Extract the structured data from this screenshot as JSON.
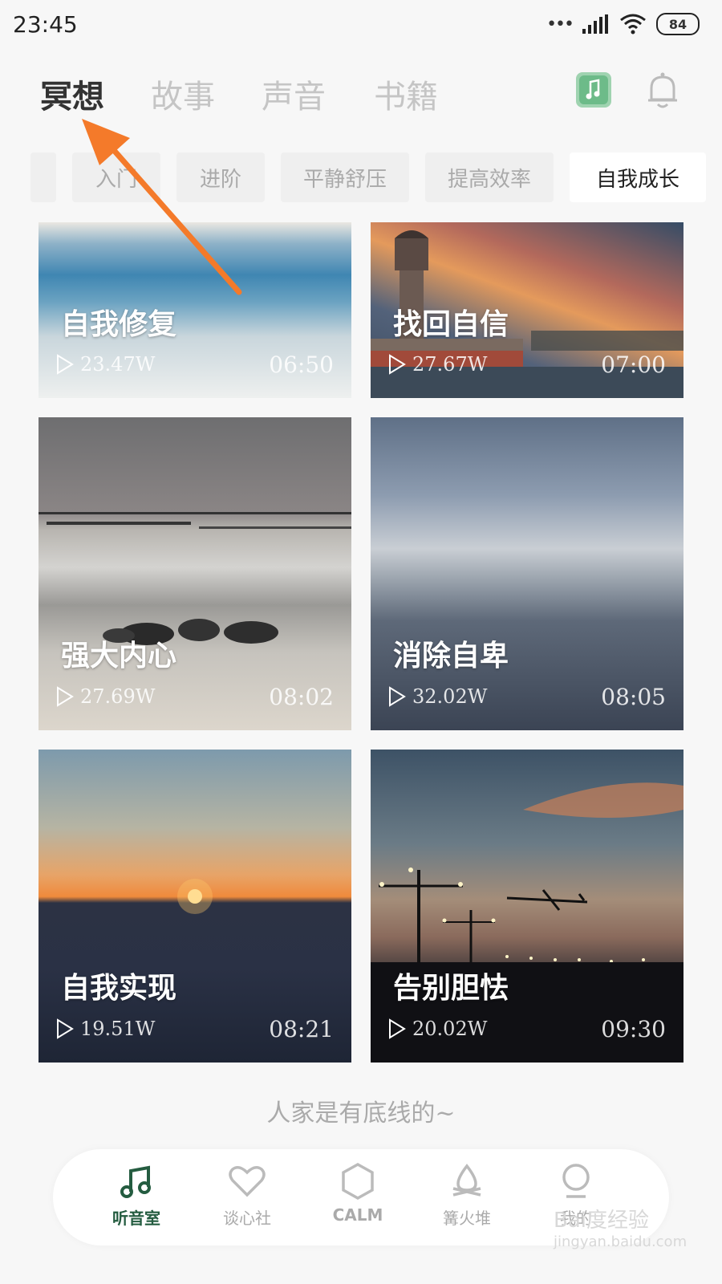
{
  "status_bar": {
    "time": "23:45",
    "battery": "84"
  },
  "top_nav": {
    "tabs": [
      "冥想",
      "故事",
      "声音",
      "书籍"
    ],
    "active_index": 0
  },
  "categories": {
    "items": [
      "",
      "入门",
      "进阶",
      "平静舒压",
      "提高效率",
      "自我成长"
    ],
    "active_index": 5
  },
  "cards": [
    {
      "title": "自我修复",
      "plays": "23.47W",
      "duration": "06:50"
    },
    {
      "title": "找回自信",
      "plays": "27.67W",
      "duration": "07:00"
    },
    {
      "title": "强大内心",
      "plays": "27.69W",
      "duration": "08:02"
    },
    {
      "title": "消除自卑",
      "plays": "32.02W",
      "duration": "08:05"
    },
    {
      "title": "自我实现",
      "plays": "19.51W",
      "duration": "08:21"
    },
    {
      "title": "告别胆怯",
      "plays": "20.02W",
      "duration": "09:30"
    }
  ],
  "footer_message": "人家是有底线的~",
  "tab_bar": {
    "items": [
      {
        "label": "听音室",
        "icon": "music-note-icon"
      },
      {
        "label": "谈心社",
        "icon": "heart-icon"
      },
      {
        "label": "CALM",
        "icon": "hexagon-icon"
      },
      {
        "label": "篝火堆",
        "icon": "campfire-icon"
      },
      {
        "label": "我的",
        "icon": "profile-icon"
      }
    ],
    "active_index": 0
  },
  "watermark": {
    "text": "Bai度经验",
    "url": "jingyan.baidu.com"
  },
  "colors": {
    "accent_green": "#245c40",
    "annotation_arrow": "#f47a2a"
  }
}
